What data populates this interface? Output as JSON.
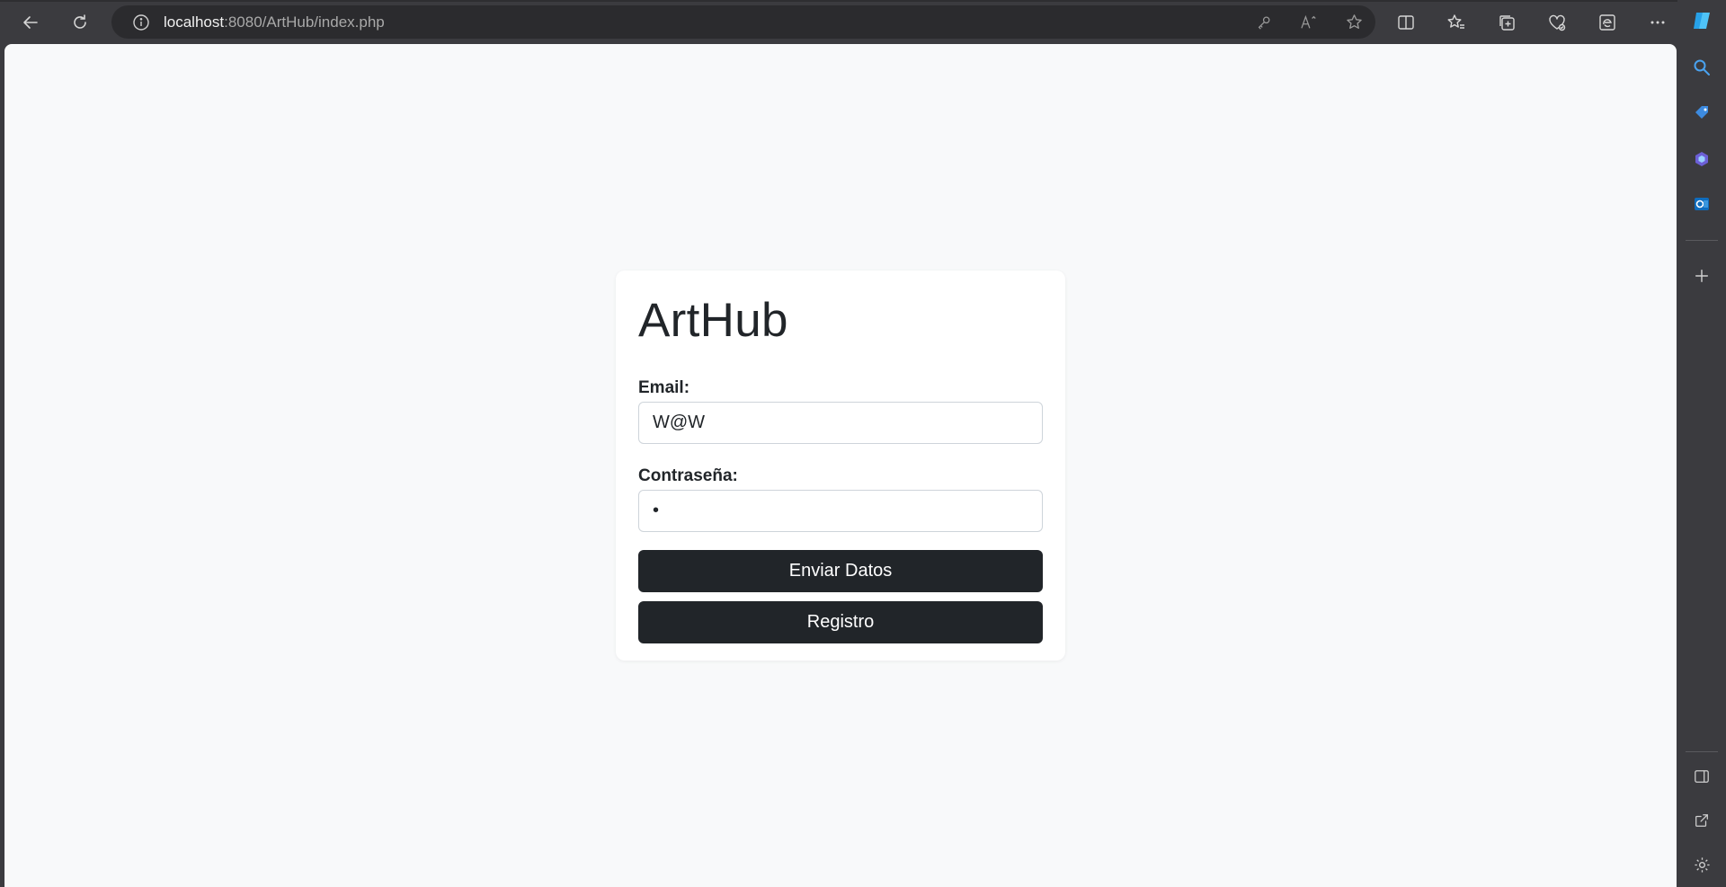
{
  "browser": {
    "url_host": "localhost",
    "url_rest": ":8080/ArtHub/index.php"
  },
  "login": {
    "title": "ArtHub",
    "email_label": "Email:",
    "email_value": "W@W",
    "password_label": "Contraseña:",
    "password_value": "•",
    "submit_label": "Enviar Datos",
    "register_label": "Registro"
  },
  "colors": {
    "button_bg": "#212529",
    "page_bg": "#f8f9fa",
    "card_bg": "#ffffff"
  }
}
